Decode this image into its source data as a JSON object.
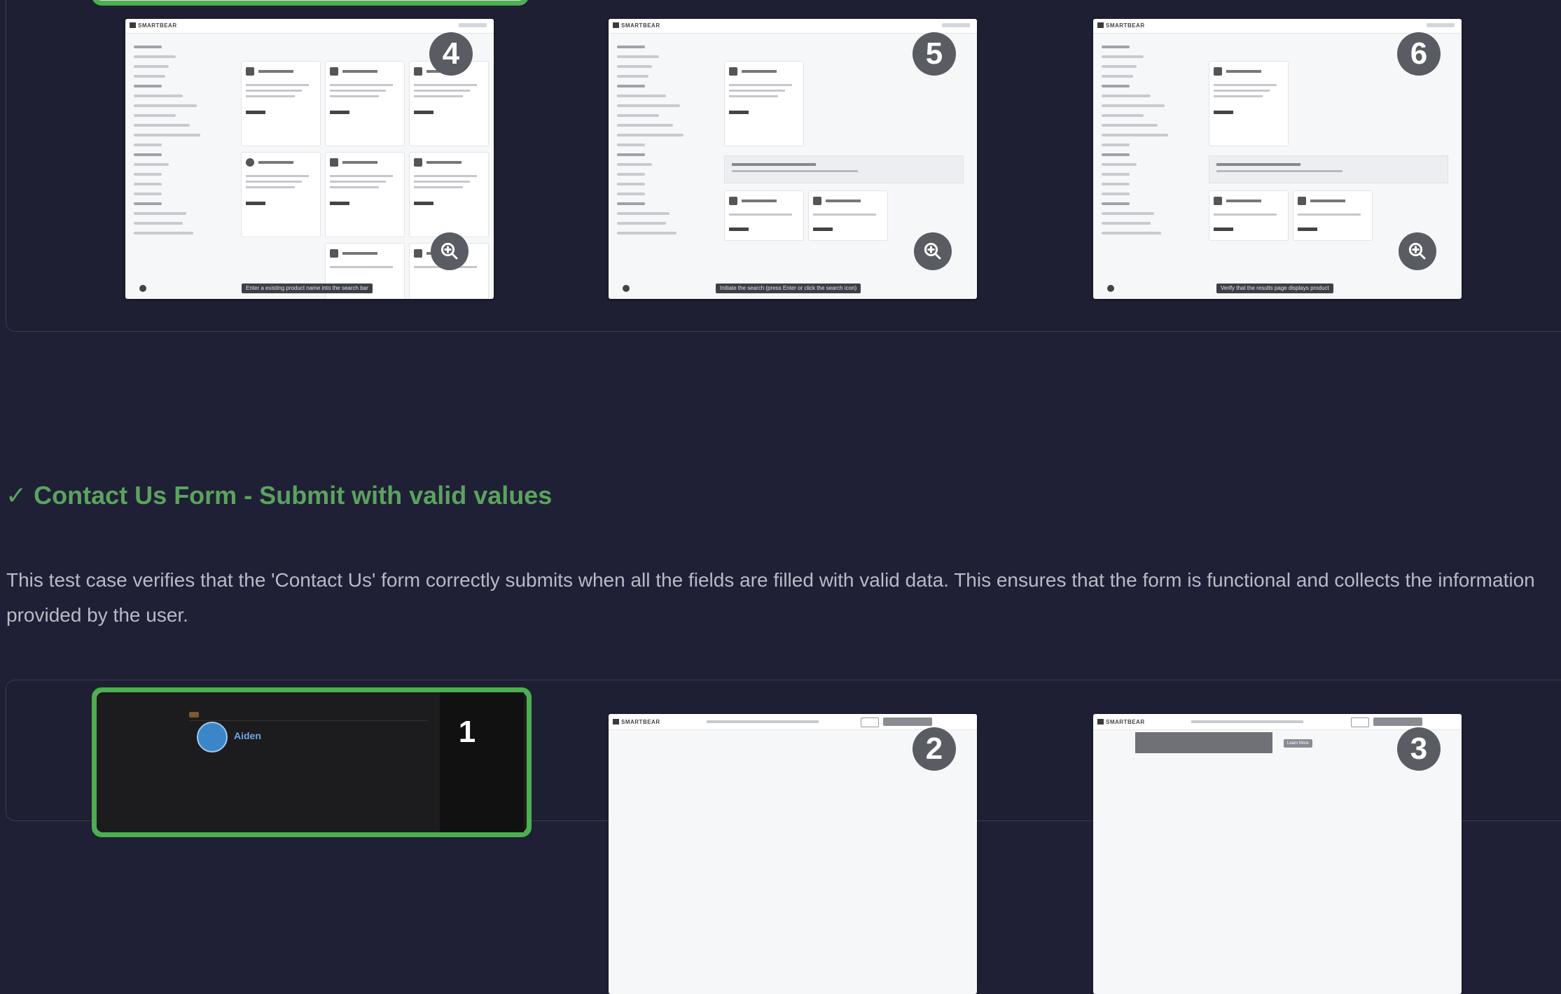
{
  "top_steps": [
    {
      "number": "4",
      "tooltip": "Enter a existing product name into the search bar"
    },
    {
      "number": "5",
      "tooltip": "Initiate the search (press Enter or click the search icon)"
    },
    {
      "number": "6",
      "tooltip": "Verify that the results page displays product"
    }
  ],
  "thumbnail_brand": "SMARTBEAR",
  "test_case": {
    "check_mark": "✓",
    "title": "Contact Us Form - Submit with valid values",
    "description": "This test case verifies that the 'Contact Us' form correctly submits when all the fields are filled with valid data. This ensures that the form is functional and collects the information provided by the user."
  },
  "bottom_steps": [
    {
      "number": "1",
      "user_name": "Aiden"
    },
    {
      "number": "2"
    },
    {
      "number": "3",
      "button_label": "Learn More"
    }
  ],
  "colors": {
    "background": "#1f2035",
    "accent_green": "#4caf50",
    "title_green": "#5ba35e"
  },
  "icons": [
    "zoom-in-icon"
  ]
}
